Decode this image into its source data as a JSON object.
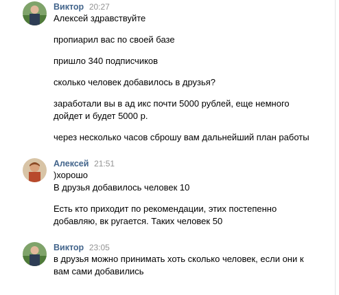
{
  "messages": [
    {
      "author": "Виктор",
      "time": "20:27",
      "lines": [
        "Алексей здравствуйте",
        "пропиарил вас по своей базе",
        "пришло 340 подписчиков",
        "сколько человек добавилось в друзья?",
        "заработали вы в ад икс почти 5000 рублей, еще немного",
        "дойдет и будет 5000 р.",
        "через несколько часов сброшу вам дальнейший план работы"
      ]
    },
    {
      "author": "Алексей",
      "time": "21:51",
      "lines": [
        ")хорошо",
        "В друзья добавилось человек 10",
        "Есть кто приходит по рекомендации, этих постепенно",
        "добавляю, вк ругается. Таких человек 50"
      ]
    },
    {
      "author": "Виктор",
      "time": "23:05",
      "lines": [
        "в друзья можно принимать хоть сколько человек, если они к",
        "вам сами добавились"
      ]
    }
  ],
  "colors": {
    "author": "#42648b",
    "time": "#939393",
    "text": "#000000"
  }
}
